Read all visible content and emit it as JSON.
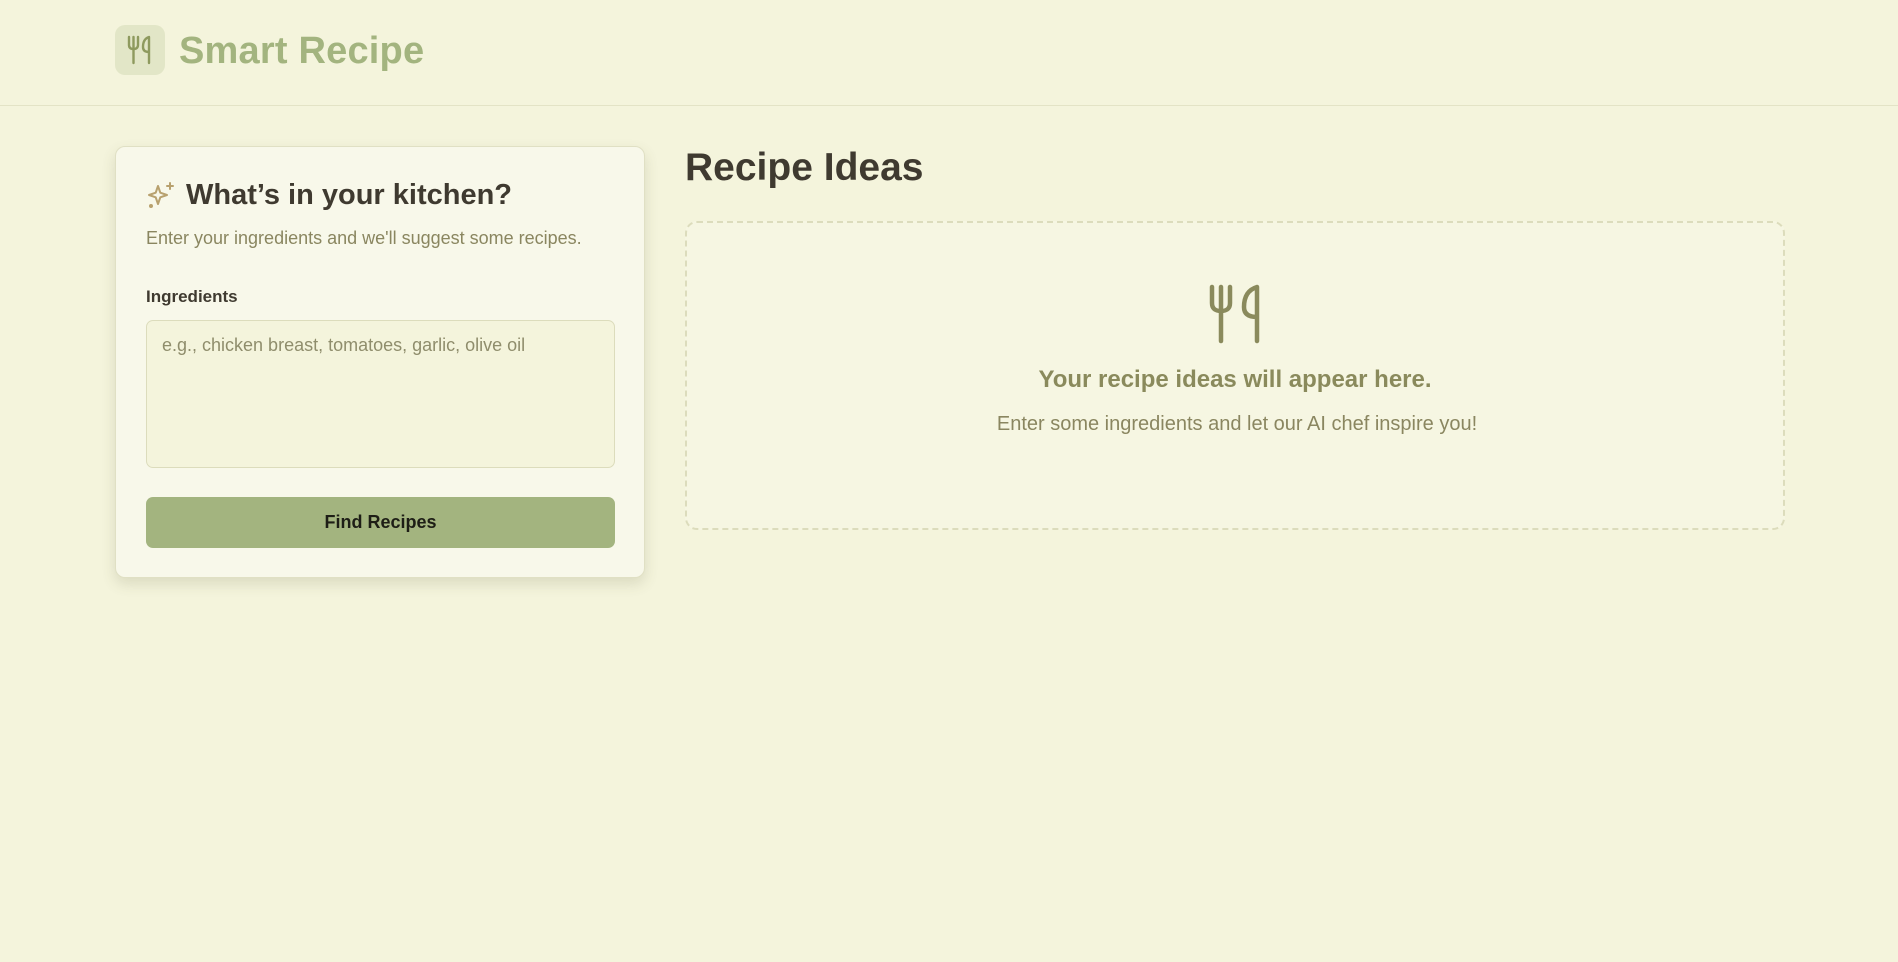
{
  "app": {
    "title": "Smart Recipe",
    "logo_icon": "utensils-icon"
  },
  "input_card": {
    "title_icon": "sparkles-icon",
    "title": "What’s in your kitchen?",
    "subtitle": "Enter your ingredients and we'll suggest some recipes.",
    "ingredients_label": "Ingredients",
    "ingredients_value": "",
    "ingredients_placeholder": "e.g., chicken breast, tomatoes, garlic, olive oil",
    "submit_label": "Find Recipes"
  },
  "results": {
    "title": "Recipe Ideas",
    "empty_icon": "utensils-icon",
    "empty_heading": "Your recipe ideas will appear here.",
    "empty_text": "Enter some ingredients and let our AI chef inspire you!"
  },
  "colors": {
    "background": "#f4f4dc",
    "accent": "#a3b47f",
    "text_dark": "#3f3a30",
    "text_muted": "#8a8660",
    "card_bg": "#f8f8ea"
  }
}
